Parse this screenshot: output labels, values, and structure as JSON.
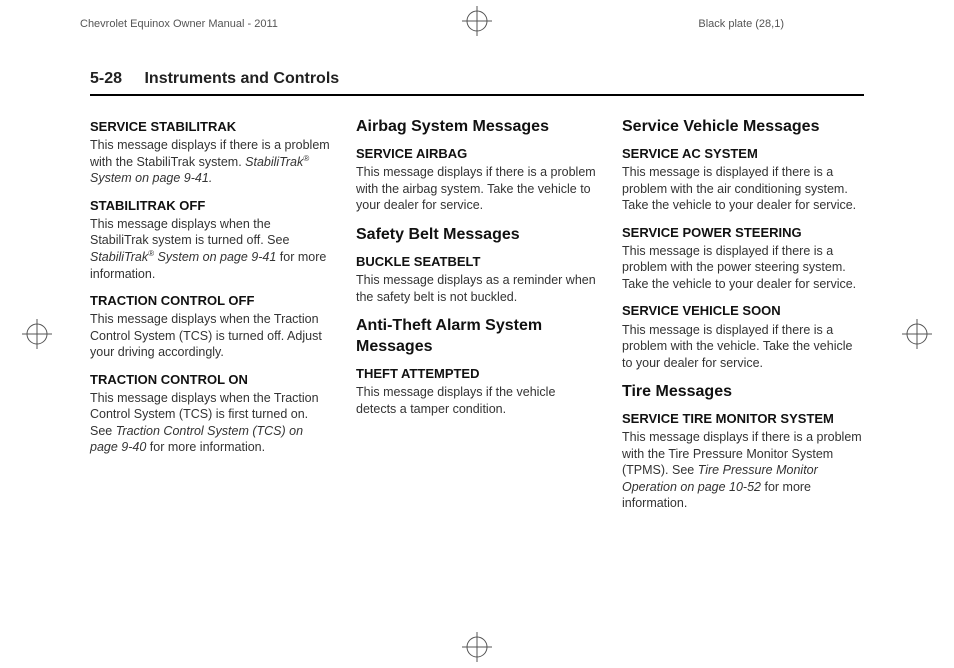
{
  "print_header": {
    "left": "Chevrolet Equinox Owner Manual - 2011",
    "right": "Black plate (28,1)"
  },
  "running_head": {
    "page_number": "5-28",
    "chapter_title": "Instruments and Controls"
  },
  "columns": {
    "col1": {
      "s1_h": "SERVICE STABILITRAK",
      "s1_p_a": "This message displays if there is a problem with the StabiliTrak system. ",
      "s1_p_xref": "StabiliTrak",
      "s1_p_sup": "®",
      "s1_p_b": " System on page 9‑41.",
      "s2_h": "STABILITRAK OFF",
      "s2_p_a": "This message displays when the StabiliTrak system is turned off. See ",
      "s2_p_xref": "StabiliTrak",
      "s2_p_sup": "®",
      "s2_p_b": " System on page 9‑41",
      "s2_p_c": " for more information.",
      "s3_h": "TRACTION CONTROL OFF",
      "s3_p": "This message displays when the Traction Control System (TCS) is turned off. Adjust your driving accordingly.",
      "s4_h": "TRACTION CONTROL ON",
      "s4_p_a": "This message displays when the Traction Control System (TCS) is first turned on. See ",
      "s4_p_xref": "Traction Control System (TCS) on page 9‑40",
      "s4_p_b": " for more information."
    },
    "col2": {
      "h_airbag": "Airbag System Messages",
      "s5_h": "SERVICE AIRBAG",
      "s5_p": "This message displays if there is a problem with the airbag system. Take the vehicle to your dealer for service.",
      "h_safety": "Safety Belt Messages",
      "s6_h": "BUCKLE SEATBELT",
      "s6_p": "This message displays as a reminder when the safety belt is not buckled.",
      "h_theft": "Anti-Theft Alarm System Messages",
      "s7_h": "THEFT ATTEMPTED",
      "s7_p": "This message displays if the vehicle detects a tamper condition."
    },
    "col3": {
      "h_service": "Service Vehicle Messages",
      "s8_h": "SERVICE AC SYSTEM",
      "s8_p": "This message is displayed if there is a problem with the air conditioning system. Take the vehicle to your dealer for service.",
      "s9_h": "SERVICE POWER STEERING",
      "s9_p": "This message is displayed if there is a problem with the power steering system. Take the vehicle to your dealer for service.",
      "s10_h": "SERVICE VEHICLE SOON",
      "s10_p": "This message is displayed if there is a problem with the vehicle. Take the vehicle to your dealer for service.",
      "h_tire": "Tire Messages",
      "s11_h": "SERVICE TIRE MONITOR SYSTEM",
      "s11_p_a": "This message displays if there is a problem with the Tire Pressure Monitor System (TPMS). See ",
      "s11_p_xref": "Tire Pressure Monitor Operation on page 10‑52",
      "s11_p_b": " for more information."
    }
  }
}
